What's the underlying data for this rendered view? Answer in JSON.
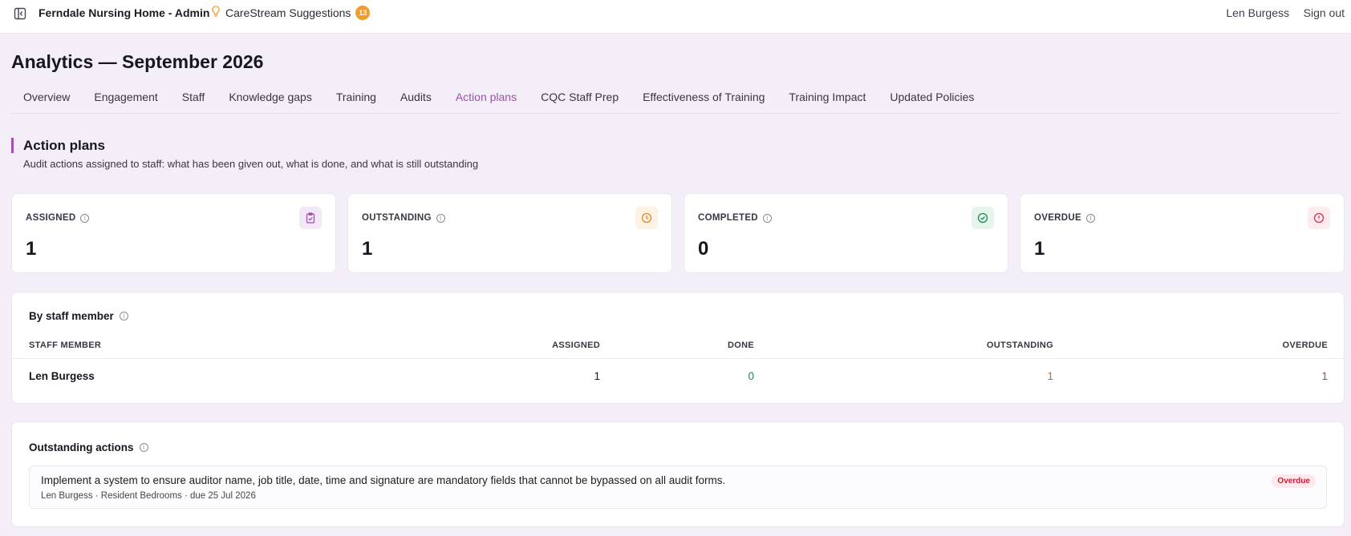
{
  "topbar": {
    "app_title": "Ferndale Nursing Home - Admin",
    "suggestions_label": "CareStream Suggestions",
    "suggestions_count": "13",
    "user_name": "Len Burgess",
    "signout_label": "Sign out"
  },
  "page": {
    "title": "Analytics — September 2026"
  },
  "tabs": [
    {
      "label": "Overview"
    },
    {
      "label": "Engagement"
    },
    {
      "label": "Staff"
    },
    {
      "label": "Knowledge gaps"
    },
    {
      "label": "Training"
    },
    {
      "label": "Audits"
    },
    {
      "label": "Action plans"
    },
    {
      "label": "CQC Staff Prep"
    },
    {
      "label": "Effectiveness of Training"
    },
    {
      "label": "Training Impact"
    },
    {
      "label": "Updated Policies"
    }
  ],
  "active_tab": "Action plans",
  "section": {
    "title": "Action plans",
    "subtitle": "Audit actions assigned to staff: what has been given out, what is done, and what is still outstanding"
  },
  "kpis": [
    {
      "label": "ASSIGNED",
      "value": "1",
      "icon": "clipboard-check-icon",
      "color": "#a14fb1",
      "bg": "#f3e8f6"
    },
    {
      "label": "OUTSTANDING",
      "value": "1",
      "icon": "clock-icon",
      "color": "#e0892a",
      "bg": "#fdf2e3"
    },
    {
      "label": "COMPLETED",
      "value": "0",
      "icon": "check-circle-icon",
      "color": "#1f8a4c",
      "bg": "#e6f5ec"
    },
    {
      "label": "OVERDUE",
      "value": "1",
      "icon": "alert-circle-icon",
      "color": "#d2344b",
      "bg": "#fdebee"
    }
  ],
  "by_staff": {
    "title": "By staff member",
    "columns": [
      "STAFF MEMBER",
      "ASSIGNED",
      "DONE",
      "OUTSTANDING",
      "OVERDUE"
    ],
    "rows": [
      {
        "staff": "Len Burgess",
        "assigned": "1",
        "done": "0",
        "outstanding": "1",
        "overdue": "1"
      }
    ]
  },
  "outstanding_actions": {
    "title": "Outstanding actions",
    "items": [
      {
        "text": "Implement a system to ensure auditor name, job title, date, time and signature are mandatory fields that cannot be bypassed on all audit forms.",
        "meta": "Len Burgess · Resident Bedrooms · due 25 Jul 2026",
        "status": "Overdue"
      }
    ]
  },
  "colors": {
    "accent": "#a14fb1",
    "done_green": "#1f8a4c",
    "outstanding_orange": "#d4621f",
    "overdue_red": "#d2344b"
  }
}
